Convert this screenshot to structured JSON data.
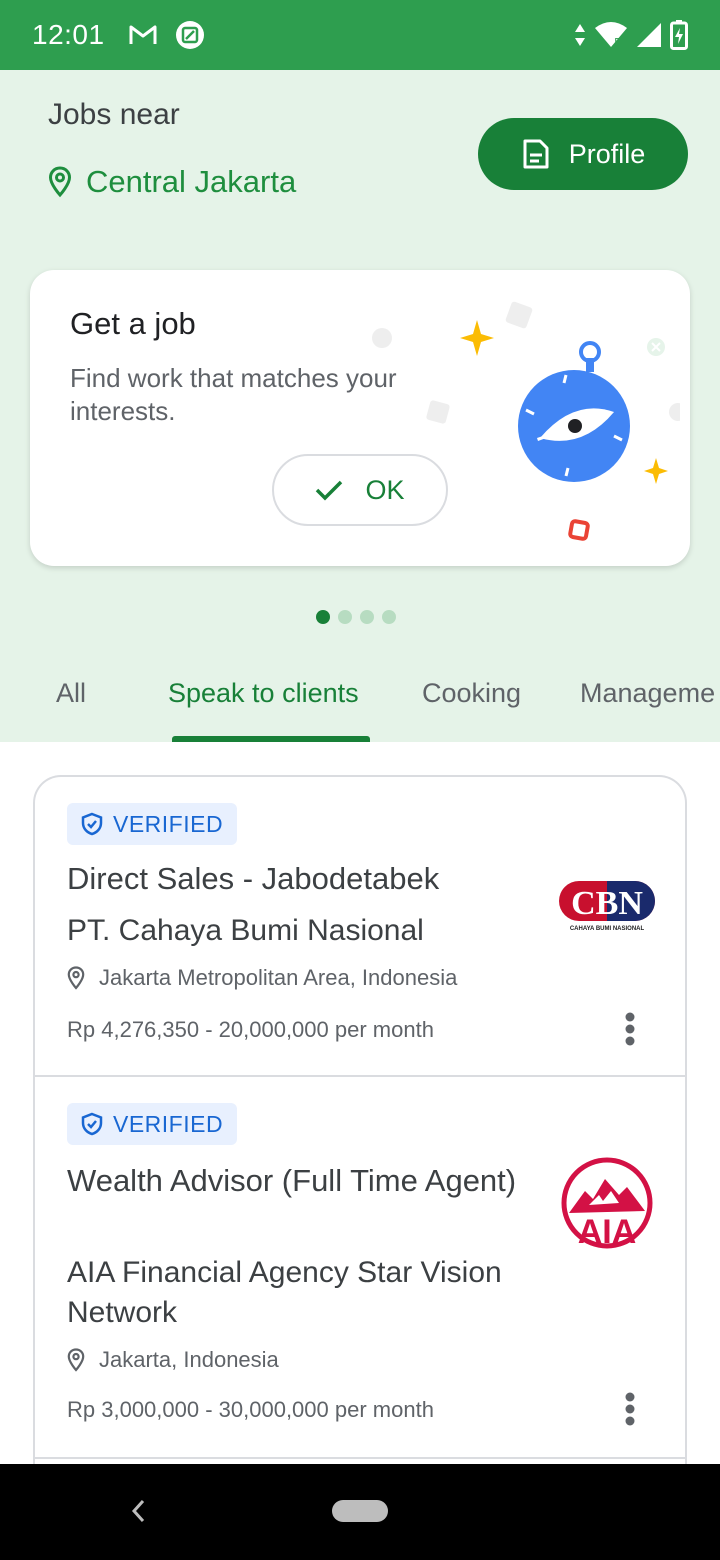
{
  "status_bar": {
    "time": "12:01",
    "network_label": "5"
  },
  "header": {
    "jobs_near_label": "Jobs near",
    "location": "Central Jakarta",
    "profile_button": "Profile"
  },
  "promo": {
    "title": "Get a job",
    "description": "Find work that matches your interests.",
    "ok_button": "OK",
    "page_count": 4,
    "active_page": 1
  },
  "tabs": [
    {
      "label": "All"
    },
    {
      "label": "Speak to clients",
      "active": true
    },
    {
      "label": "Cooking"
    },
    {
      "label": "Manageme"
    }
  ],
  "jobs": [
    {
      "badge": "VERIFIED",
      "title": "Direct Sales - Jabodetabek",
      "company": "PT. Cahaya Bumi Nasional",
      "location": "Jakarta Metropolitan Area, Indonesia",
      "salary": "Rp 4,276,350 - 20,000,000 per month",
      "logo_text": "CBN",
      "logo_subtext": "CAHAYA BUMI NASIONAL"
    },
    {
      "badge": "VERIFIED",
      "title": "Wealth Advisor (Full Time Agent)",
      "company": "AIA Financial Agency Star Vision Network",
      "location": "Jakarta, Indonesia",
      "salary": "Rp 3,000,000 - 30,000,000 per month",
      "logo_text": "AIA"
    }
  ],
  "colors": {
    "status_bar": "#2e9e4f",
    "header_bg": "#e5f3e8",
    "accent": "#188038",
    "verified_bg": "#e8f0fe",
    "verified_text": "#1967d2"
  }
}
